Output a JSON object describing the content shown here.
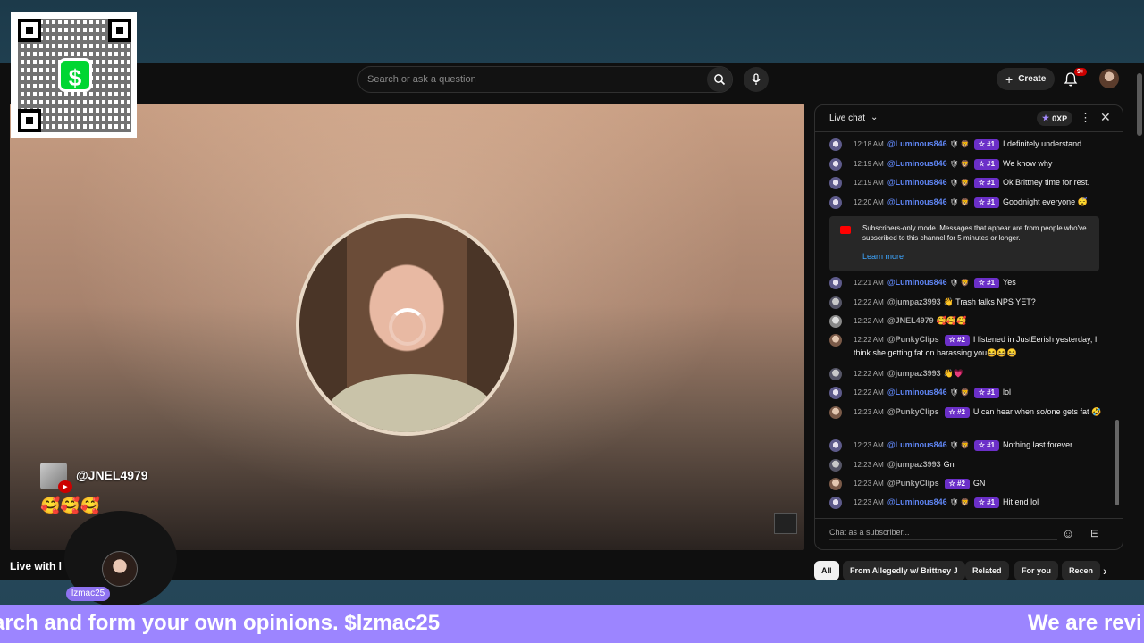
{
  "search": {
    "placeholder": "Search or ask a question"
  },
  "header": {
    "create_label": "Create",
    "notification_count": "9+"
  },
  "video": {
    "viewer_name": "@JNEL4979",
    "viewer_emojis": "🥰🥰🥰",
    "title": "Live with l"
  },
  "chat": {
    "title": "Live chat",
    "xp_label": "0XP",
    "input_placeholder": "Chat as a subscriber...",
    "notice": {
      "text": "Subscribers-only mode. Messages that appear are from people who've subscribed to this channel for 5 minutes or longer.",
      "link": "Learn more"
    },
    "messages": [
      {
        "time": "12:18 AM",
        "author": "@Luminous846",
        "rank": "#1",
        "text": "I definitely understand"
      },
      {
        "time": "12:19 AM",
        "author": "@Luminous846",
        "rank": "#1",
        "text": "We know why"
      },
      {
        "time": "12:19 AM",
        "author": "@Luminous846",
        "rank": "#1",
        "text": "Ok Brittney time for rest."
      },
      {
        "time": "12:20 AM",
        "author": "@Luminous846",
        "rank": "#1",
        "text": "Goodnight everyone 😴"
      },
      {
        "time": "12:21 AM",
        "author": "@Luminous846",
        "rank": "#1",
        "text": "Yes"
      },
      {
        "time": "12:22 AM",
        "author": "@jumpaz3993",
        "rank": "",
        "text": "👋 Trash talks NPS YET?"
      },
      {
        "time": "12:22 AM",
        "author": "@JNEL4979",
        "rank": "",
        "text": "🥰🥰🥰"
      },
      {
        "time": "12:22 AM",
        "author": "@PunkyClips",
        "rank": "#2",
        "text": "I listened in JustEerish yesterday, I think she getting fat on harassing you😆😆😆"
      },
      {
        "time": "12:22 AM",
        "author": "@jumpaz3993",
        "rank": "",
        "text": "👋💗"
      },
      {
        "time": "12:22 AM",
        "author": "@Luminous846",
        "rank": "#1",
        "text": "lol"
      },
      {
        "time": "12:23 AM",
        "author": "@PunkyClips",
        "rank": "#2",
        "text": "U can hear when so/one gets fat 🤣"
      },
      {
        "time": "12:23 AM",
        "author": "@Luminous846",
        "rank": "#1",
        "text": "Nothing last forever"
      },
      {
        "time": "12:23 AM",
        "author": "@jumpaz3993",
        "rank": "",
        "text": "Gn"
      },
      {
        "time": "12:23 AM",
        "author": "@PunkyClips",
        "rank": "#2",
        "text": "GN"
      },
      {
        "time": "12:23 AM",
        "author": "@Luminous846",
        "rank": "#1",
        "text": "Hit end lol"
      }
    ]
  },
  "chips": [
    "All",
    "From Allegedly w/ Brittney J",
    "Related",
    "For you",
    "Recen"
  ],
  "overlay": {
    "qr_symbol": "$",
    "host_name": "lzmac25",
    "ticker_left": "arch and form your own opinions. $lzmac25",
    "ticker_right": "We are revi"
  },
  "colors": {
    "moderator_name": "#5e84f1",
    "rank_badge": "#6b2fc8",
    "ticker_bg": "#9c85ff",
    "cashapp_green": "#00d632",
    "accent_link": "#3ea6ff"
  }
}
